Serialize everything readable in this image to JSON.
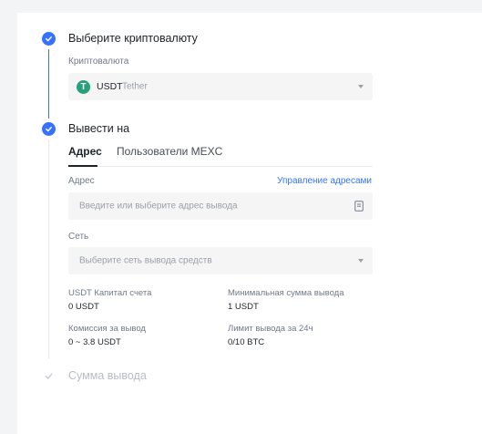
{
  "steps": {
    "select_crypto": {
      "title": "Выберите криптовалюту",
      "field_label": "Криптовалюта",
      "coin_symbol": "USDT",
      "coin_name": "Tether",
      "coin_glyph": "T",
      "coin_color": "#26a17b"
    },
    "withdraw_to": {
      "title": "Вывести на",
      "tabs": [
        {
          "label": "Адрес",
          "active": true
        },
        {
          "label": "Пользователи MEXC",
          "active": false
        }
      ],
      "address_label": "Адрес",
      "manage_link": "Управление адресами",
      "address_placeholder": "Введите или выберите адрес вывода",
      "network_label": "Сеть",
      "network_placeholder": "Выберите сеть вывода средств"
    },
    "amount": {
      "title": "Сумма вывода"
    }
  },
  "info": {
    "balance_label": "USDT Капитал счета",
    "balance_value": "0 USDT",
    "min_label": "Минимальная сумма вывода",
    "min_value": "1 USDT",
    "fee_label": "Комиссия за вывод",
    "fee_value": "0 ~ 3.8 USDT",
    "limit_label": "Лимит вывода за 24ч",
    "limit_value": "0/10 BTC"
  },
  "colors": {
    "accent": "#3772ff",
    "page_bg": "#f3f4f6"
  },
  "icons": {
    "step_done": "check-circle-icon",
    "step_pending": "check-icon",
    "address_book": "address-book-icon",
    "dropdown": "chevron-down-icon"
  }
}
